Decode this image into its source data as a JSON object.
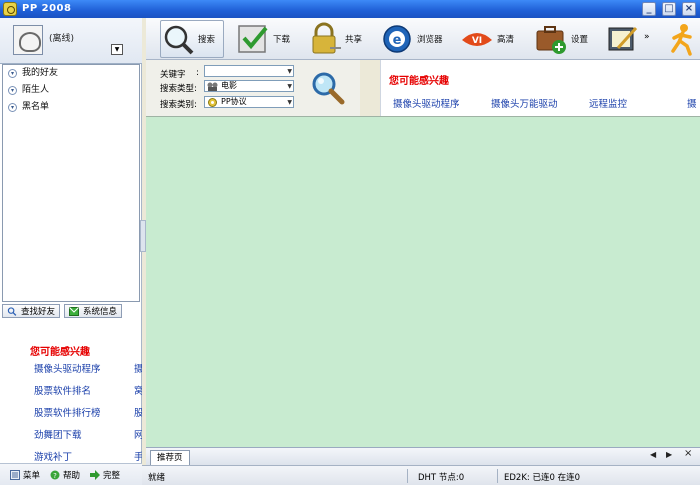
{
  "window": {
    "title": "PP 2008"
  },
  "profile": {
    "status": "(离线)"
  },
  "friend_groups": [
    "我的好友",
    "陌生人",
    "黑名单"
  ],
  "left_buttons": {
    "find_friend": "查找好友",
    "system_info": "系统信息"
  },
  "left_interest": {
    "heading": "您可能感兴趣",
    "rows": [
      {
        "a": "摄像头驱动程序",
        "b": "摄"
      },
      {
        "a": "股票软件排名",
        "b": "窝"
      },
      {
        "a": "股票软件排行榜",
        "b": "股"
      },
      {
        "a": "劲舞团下载",
        "b": "网"
      },
      {
        "a": "游戏补丁",
        "b": "手"
      }
    ]
  },
  "left_bottom": {
    "menu": "菜单",
    "help": "帮助",
    "complete": "完整"
  },
  "toolbar": {
    "search": "搜索",
    "download": "下载",
    "share": "共享",
    "browser": "浏览器",
    "hd": "高清",
    "settings": "设置"
  },
  "search_panel": {
    "keyword_label": "关键字",
    "keyword_sep": ":",
    "keyword_value": "",
    "type_label": "搜索类型:",
    "type_value": "电影",
    "category_label": "搜索类别:",
    "category_value": "PP协议"
  },
  "recommend": {
    "heading": "您可能感兴趣",
    "links": [
      "摄像头驱动程序",
      "摄像头万能驱动",
      "远程监控",
      "摄"
    ]
  },
  "tabs": [
    "推荐页"
  ],
  "statusbar": {
    "ready": "就绪",
    "dht": "DHT 节点:0",
    "ed2k": "ED2K: 已连0 在连0"
  },
  "colors": {
    "main_bg": "#c8ebd0",
    "interest_heading": "#e60000",
    "link": "#1a3faa",
    "titlebar": "#1f5fd6"
  }
}
